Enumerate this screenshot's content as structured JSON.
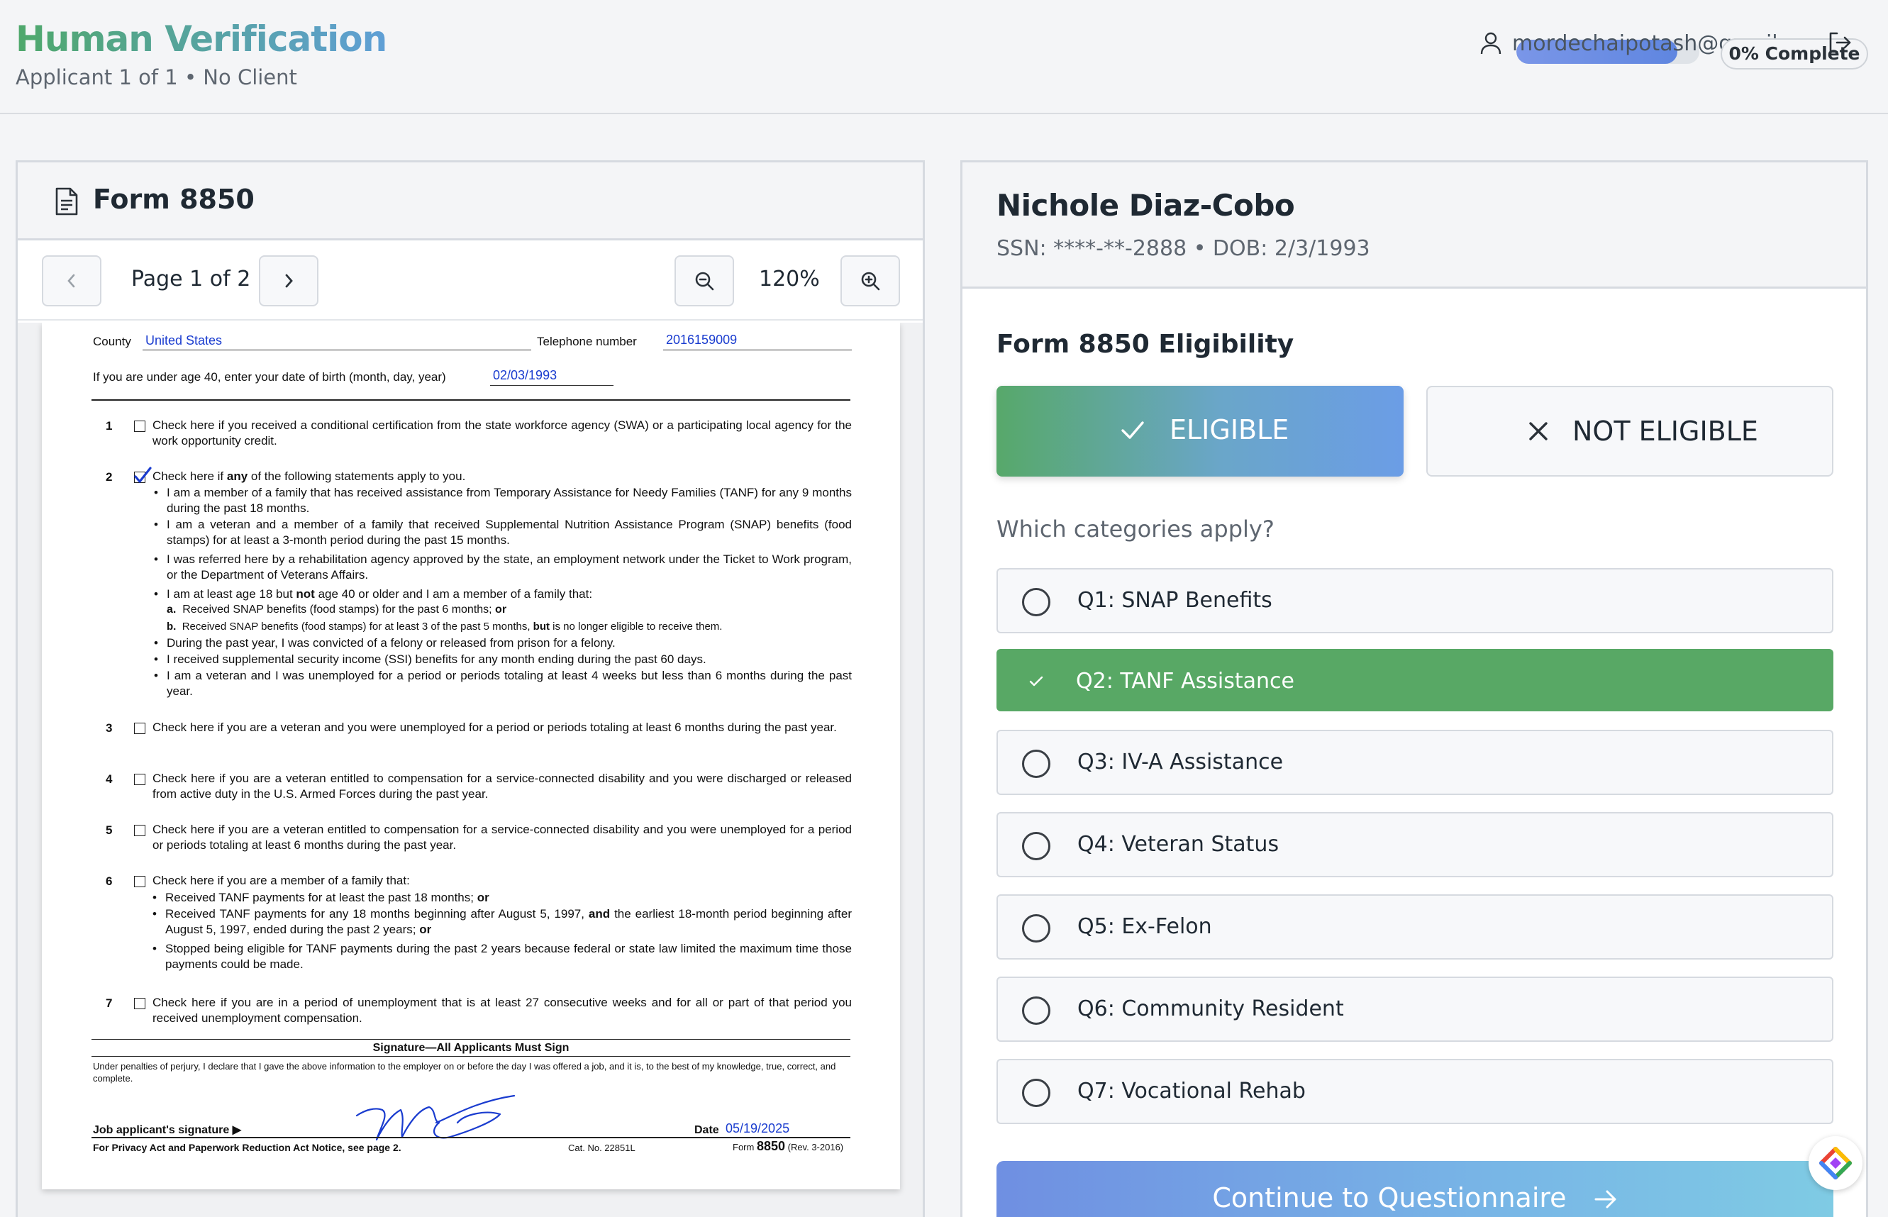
{
  "header": {
    "app_title": "Human Verification",
    "subtitle": "Applicant 1 of 1 • No Client",
    "user_email": "mordechaipotash@gmail.com",
    "progress_label": "0% Complete",
    "progress_value": 0
  },
  "document": {
    "title": "Form 8850",
    "page_label": "Page 1 of 2",
    "zoom_label": "120%",
    "county_label": "County",
    "county_value": "United States",
    "phone_label": "Telephone number",
    "phone_value": "2016159009",
    "dob_label": "If you are under age 40, enter your date of birth (month, day, year)",
    "dob_value": "02/03/1993",
    "items": {
      "n1": "1",
      "n2": "2",
      "n3": "3",
      "n4": "4",
      "n5": "5",
      "n6": "6",
      "n7": "7",
      "i1": "Check here if you received a conditional certification from the state workforce agency (SWA) or a participating local agency for the work opportunity credit.",
      "i2_pre": "Check here if ",
      "i2_bold": "any",
      "i2_post": " of the following statements apply to you.",
      "i2_b1": "I am a member of a family that has received assistance from Temporary Assistance for Needy Families (TANF) for any 9 months during the past 18 months.",
      "i2_b2": "I am a veteran and a member of a family that received Supplemental Nutrition Assistance Program (SNAP) benefits (food stamps) for at least a 3-month period during the past 15 months.",
      "i2_b3": "I was referred here by a rehabilitation agency approved by the state, an employment network under the Ticket to Work program, or the Department of Veterans Affairs.",
      "i2_b4_pre": "I am at least age 18 but ",
      "i2_b4_bold": "not",
      "i2_b4_post": " age 40 or older and I am a member of a family that:",
      "i2_b4a_l": "a.",
      "i2_b4a": "Received SNAP benefits (food stamps) for the past 6 months; ",
      "i2_b4a_or": "or",
      "i2_b4b_l": "b.",
      "i2_b4b_pre": "Received SNAP benefits (food stamps) for at least 3 of the past 5 months, ",
      "i2_b4b_but": "but",
      "i2_b4b_post": " is no longer eligible to receive them.",
      "i2_b5": "During the past year, I was convicted of a felony or released from prison for a felony.",
      "i2_b6": "I received supplemental security income (SSI) benefits for any month ending during the past 60 days.",
      "i2_b7": "I am a veteran and I was unemployed for a period or periods totaling at least 4 weeks but less than 6 months during the past year.",
      "i3": "Check here if you are a veteran and you were unemployed for a period or periods totaling at least 6 months during the past year.",
      "i4": "Check here if you are a veteran entitled to compensation for a service-connected disability and you were discharged or released from active duty in the U.S. Armed Forces during the past year.",
      "i5": "Check here if you are a veteran entitled to compensation for a service-connected disability and you were unemployed for a period or periods totaling at least 6 months during the past year.",
      "i6": "Check here if you are a member of a family that:",
      "i6_b1_pre": "Received TANF payments for at least the past 18 months; ",
      "i6_b1_or": "or",
      "i6_b2_pre": "Received TANF payments for any 18 months beginning after August 5, 1997, ",
      "i6_b2_and": "and",
      "i6_b2_mid": " the earliest 18-month period beginning after August 5, 1997, ended during the past 2 years; ",
      "i6_b2_or": "or",
      "i6_b3": "Stopped being eligible for TANF payments during the past 2 years because federal or state law limited the maximum time those payments could be made.",
      "i7": "Check here if you are in a period of unemployment that is at least 27 consecutive weeks and for all or part of that period you received unemployment compensation."
    },
    "signature": {
      "heading": "Signature—All Applicants Must Sign",
      "perjury": "Under penalties of perjury, I declare that I gave the above information to the employer on or before the day I was offered a job, and it is, to the best of my knowledge, true, correct, and complete.",
      "sig_label": "Job applicant's signature ▶",
      "date_label": "Date",
      "date_value": "05/19/2025",
      "privacy": "For Privacy Act and Paperwork Reduction Act Notice, see page 2.",
      "cat_no": "Cat. No. 22851L",
      "form_pre": "Form ",
      "form_no": "8850",
      "form_rev": " (Rev. 3-2016)"
    }
  },
  "applicant": {
    "name": "Nichole Diaz-Cobo",
    "meta": "SSN: ****-**-2888 • DOB: 2/3/1993"
  },
  "eligibility": {
    "title": "Form 8850 Eligibility",
    "eligible_label": "ELIGIBLE",
    "not_eligible_label": "NOT ELIGIBLE",
    "selected": "eligible",
    "question": "Which categories apply?",
    "categories": [
      {
        "label": "Q1: SNAP Benefits",
        "selected": false
      },
      {
        "label": "Q2: TANF Assistance",
        "selected": true
      },
      {
        "label": "Q3: IV-A Assistance",
        "selected": false
      },
      {
        "label": "Q4: Veteran Status",
        "selected": false
      },
      {
        "label": "Q5: Ex-Felon",
        "selected": false
      },
      {
        "label": "Q6: Community Resident",
        "selected": false
      },
      {
        "label": "Q7: Vocational Rehab",
        "selected": false
      }
    ],
    "continue_label": "Continue to Questionnaire"
  },
  "colors": {
    "eligible_green": "#57a86a",
    "selected_category": "#58a865",
    "accent_blue": "#6f8fe2",
    "form_fill_blue": "#1a3ccf"
  },
  "icons": [
    "user-icon",
    "logout-icon",
    "document-icon",
    "chevron-left-icon",
    "chevron-right-icon",
    "zoom-out-icon",
    "zoom-in-icon",
    "check-icon",
    "close-icon",
    "arrow-right-icon",
    "app-launcher-icon"
  ]
}
